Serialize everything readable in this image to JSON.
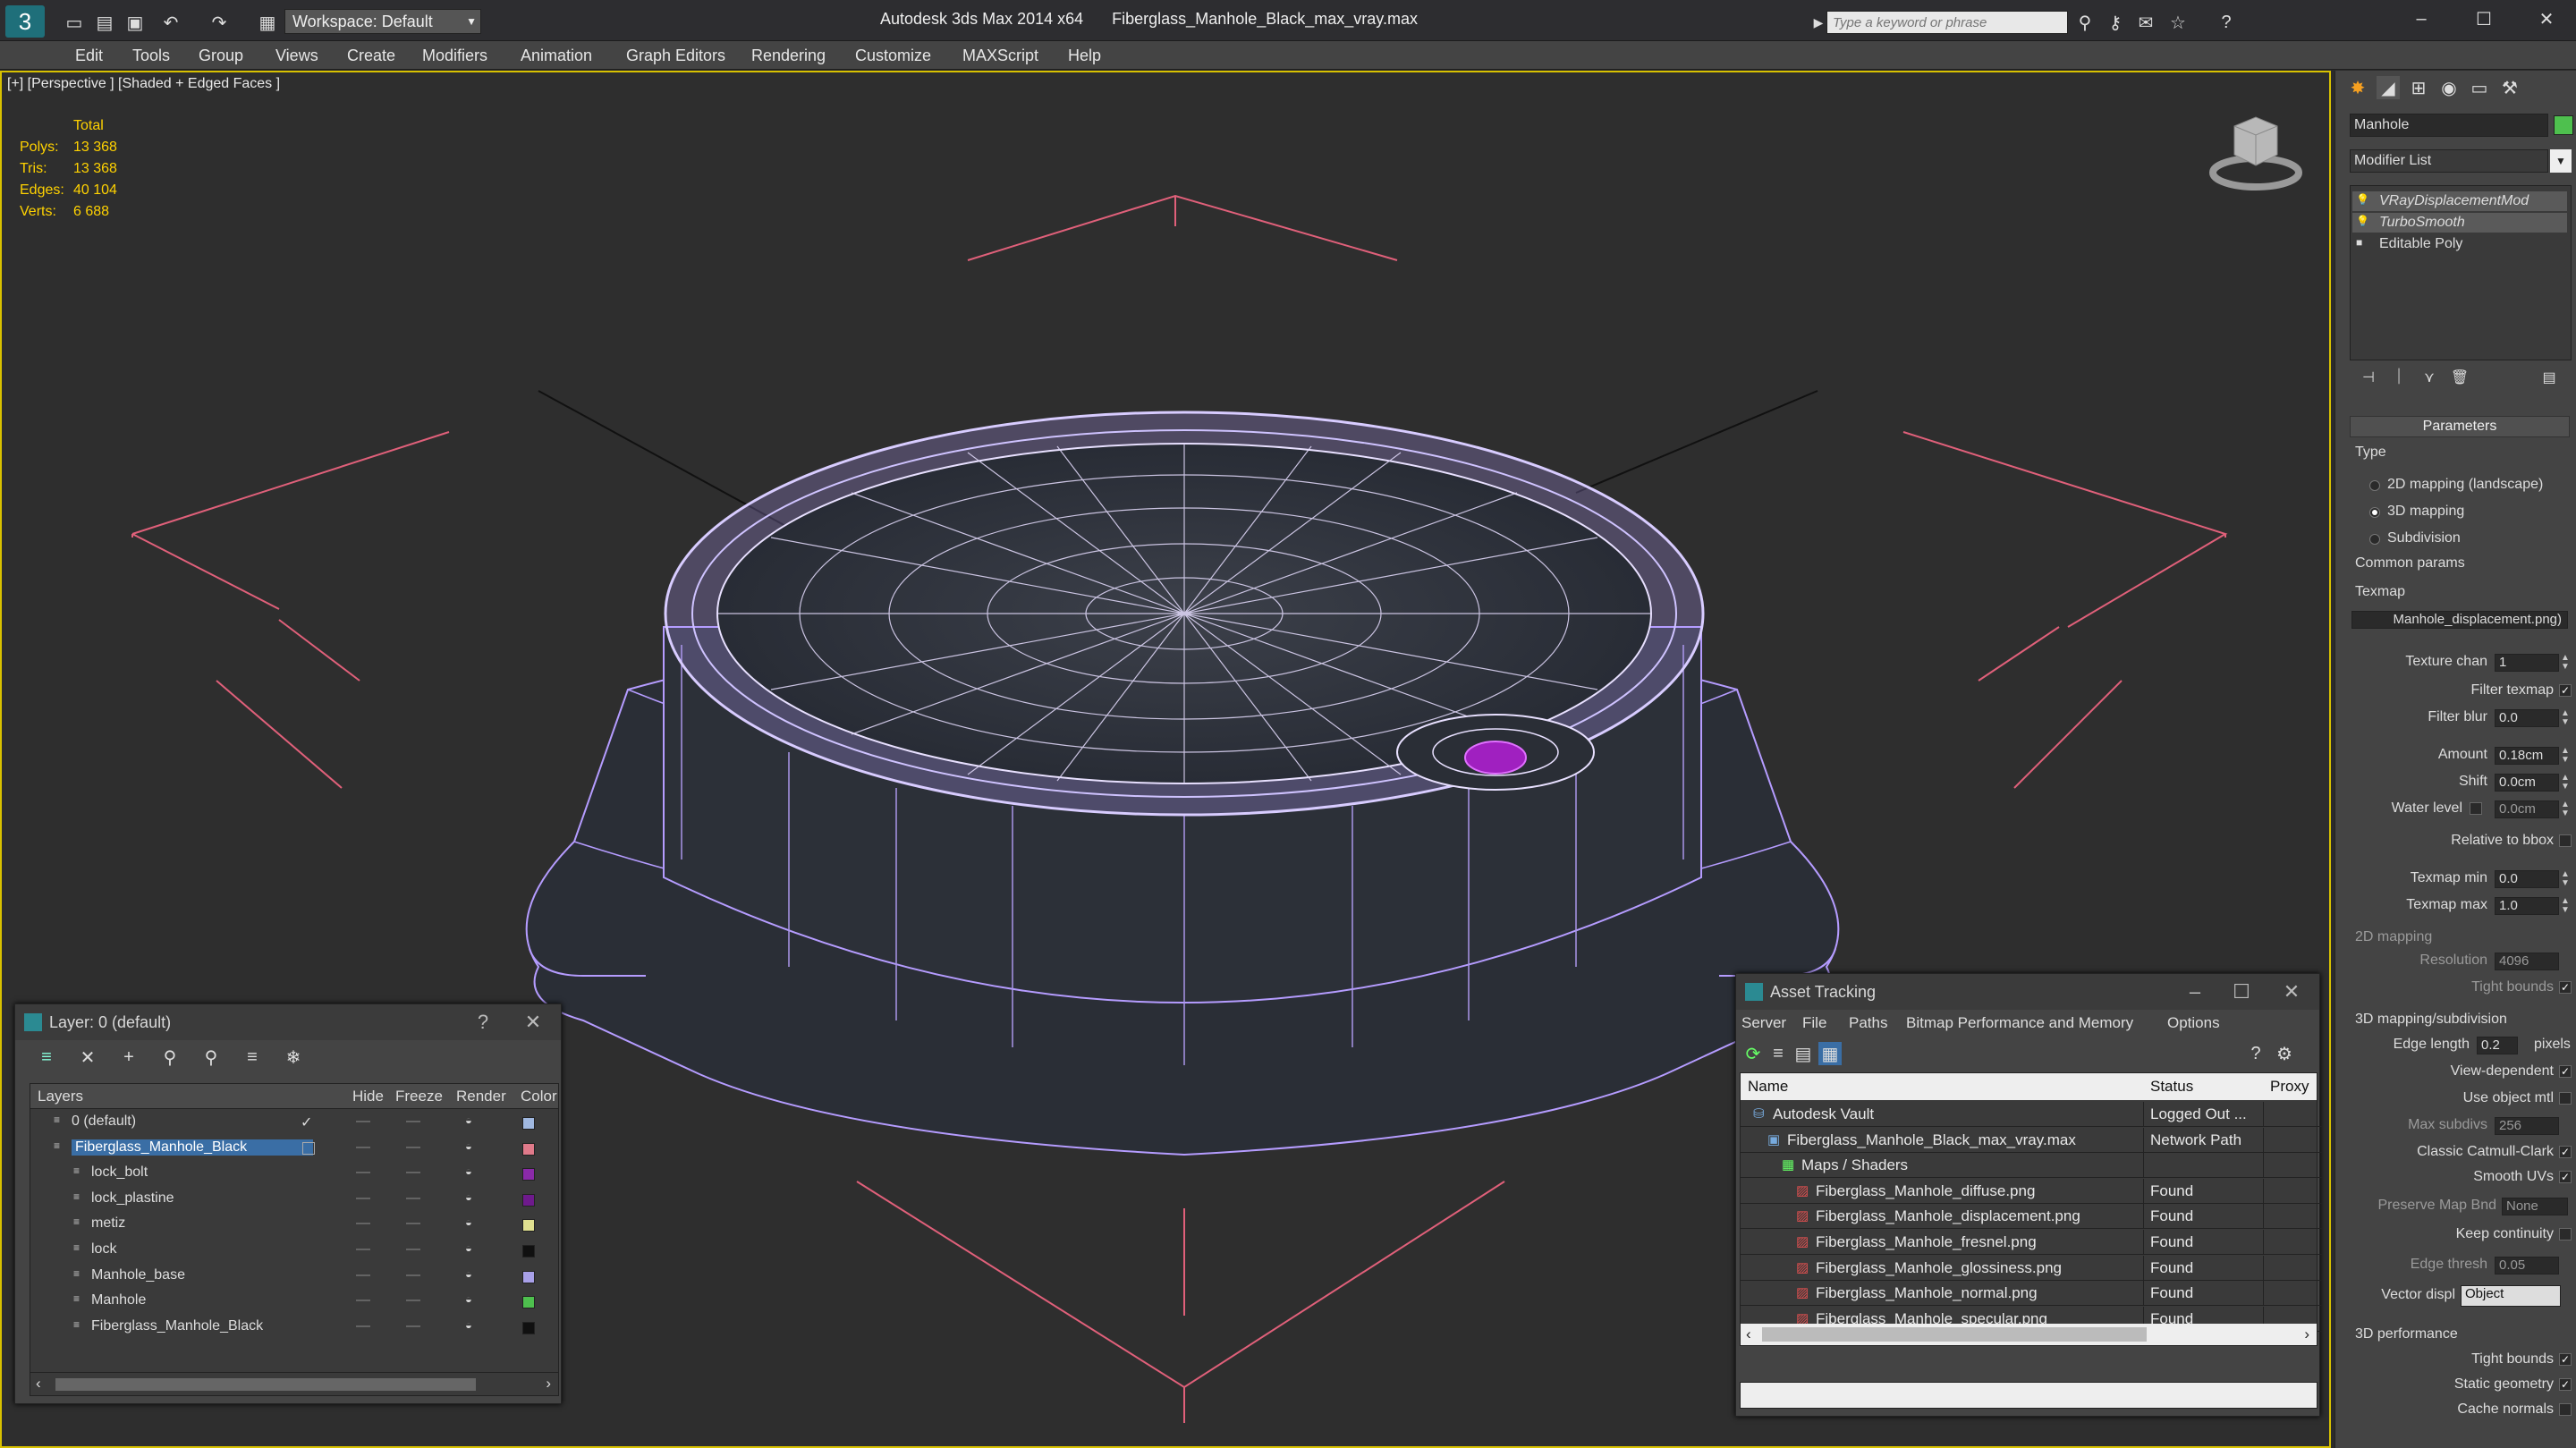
{
  "app": {
    "title": "Autodesk 3ds Max  2014 x64",
    "file": "Fiberglass_Manhole_Black_max_vray.max",
    "workspace": "Workspace: Default",
    "search_placeholder": "Type a keyword or phrase"
  },
  "menu": [
    "Edit",
    "Tools",
    "Group",
    "Views",
    "Create",
    "Modifiers",
    "Animation",
    "Graph Editors",
    "Rendering",
    "Customize",
    "MAXScript",
    "Help"
  ],
  "viewport": {
    "label": "[+] [Perspective ] [Shaded + Edged Faces ]",
    "stats": {
      "header": "Total",
      "rows": [
        {
          "label": "Polys:",
          "value": "13 368"
        },
        {
          "label": "Tris:",
          "value": "13 368"
        },
        {
          "label": "Edges:",
          "value": "40 104"
        },
        {
          "label": "Verts:",
          "value": "6 688"
        }
      ]
    }
  },
  "command_panel": {
    "object_name": "Manhole",
    "modifier_list": "Modifier List",
    "stack": [
      "VRayDisplacementMod",
      "TurboSmooth",
      "Editable Poly"
    ],
    "parameters_title": "Parameters",
    "type_label": "Type",
    "type_options": [
      "2D mapping (landscape)",
      "3D mapping",
      "Subdivision"
    ],
    "common_params": "Common params",
    "texmap_label": "Texmap",
    "texmap_value": "Manhole_displacement.png)",
    "fields": [
      {
        "label": "Texture chan",
        "value": "1"
      },
      {
        "label": "Filter texmap",
        "check": true
      },
      {
        "label": "Filter blur",
        "value": "0.0"
      },
      {
        "label": "Amount",
        "value": "0.18cm"
      },
      {
        "label": "Shift",
        "value": "0.0cm"
      },
      {
        "label": "Water level",
        "value": "0.0cm"
      },
      {
        "label": "Relative to bbox",
        "check": false
      },
      {
        "label": "Texmap min",
        "value": "0.0"
      },
      {
        "label": "Texmap max",
        "value": "1.0"
      }
    ],
    "mapping2d": "2D mapping",
    "resolution_label": "Resolution",
    "resolution": "4096",
    "tight_bounds_label": "Tight bounds",
    "mapping3d": "3D mapping/subdivision",
    "edge_length_label": "Edge length",
    "edge_length": "0.2",
    "pixels": "pixels",
    "view_dependent": "View-dependent",
    "use_object_mtl": "Use object mtl",
    "max_subdivs_label": "Max subdivs",
    "max_subdivs": "256",
    "classic_catmull": "Classic Catmull-Clark",
    "smooth_uvs": "Smooth UVs",
    "preserve_map": "Preserve Map Bnd",
    "preserve_map_value": "None",
    "keep_continuity": "Keep continuity",
    "edge_thresh_label": "Edge thresh",
    "edge_thresh": "0.05",
    "vector_displ_label": "Vector displ",
    "vector_displ": "Object",
    "perf_title": "3D performance",
    "perf": [
      "Tight bounds",
      "Static geometry",
      "Cache normals"
    ]
  },
  "layer_window": {
    "title": "Layer: 0 (default)",
    "columns": [
      "Layers",
      "Hide",
      "Freeze",
      "Render",
      "Color"
    ],
    "rows": [
      {
        "name": "0 (default)",
        "indent": 1,
        "color": "#a0b8e0",
        "check": "✓"
      },
      {
        "name": "Fiberglass_Manhole_Black",
        "indent": 1,
        "color": "#e07a8a",
        "selected": true
      },
      {
        "name": "lock_bolt",
        "indent": 2,
        "color": "#8a2aa8"
      },
      {
        "name": "lock_plastine",
        "indent": 2,
        "color": "#6e1a8c"
      },
      {
        "name": "metiz",
        "indent": 2,
        "color": "#e0e090"
      },
      {
        "name": "lock",
        "indent": 2,
        "color": "#101010"
      },
      {
        "name": "Manhole_base",
        "indent": 2,
        "color": "#a8a0e8"
      },
      {
        "name": "Manhole",
        "indent": 2,
        "color": "#4ec04e"
      },
      {
        "name": "Fiberglass_Manhole_Black",
        "indent": 2,
        "color": "#101010"
      }
    ]
  },
  "asset_window": {
    "title": "Asset Tracking",
    "menu": [
      "Server",
      "File",
      "Paths",
      "Bitmap Performance and Memory",
      "Options"
    ],
    "columns": [
      "Name",
      "Status",
      "Proxy"
    ],
    "rows": [
      {
        "name": "Autodesk Vault",
        "status": "Logged Out ...",
        "indent": 1
      },
      {
        "name": "Fiberglass_Manhole_Black_max_vray.max",
        "status": "Network Path",
        "indent": 2
      },
      {
        "name": "Maps / Shaders",
        "status": "",
        "indent": 3
      },
      {
        "name": "Fiberglass_Manhole_diffuse.png",
        "status": "Found",
        "indent": 4
      },
      {
        "name": "Fiberglass_Manhole_displacement.png",
        "status": "Found",
        "indent": 4
      },
      {
        "name": "Fiberglass_Manhole_fresnel.png",
        "status": "Found",
        "indent": 4
      },
      {
        "name": "Fiberglass_Manhole_glossiness.png",
        "status": "Found",
        "indent": 4
      },
      {
        "name": "Fiberglass_Manhole_normal.png",
        "status": "Found",
        "indent": 4
      },
      {
        "name": "Fiberglass_Manhole_specular.png",
        "status": "Found",
        "indent": 4
      }
    ]
  },
  "colors": {
    "accent": "#d8c100",
    "wire": "#b59cff",
    "grid": "#e0607a",
    "stats": "#ffd200"
  }
}
